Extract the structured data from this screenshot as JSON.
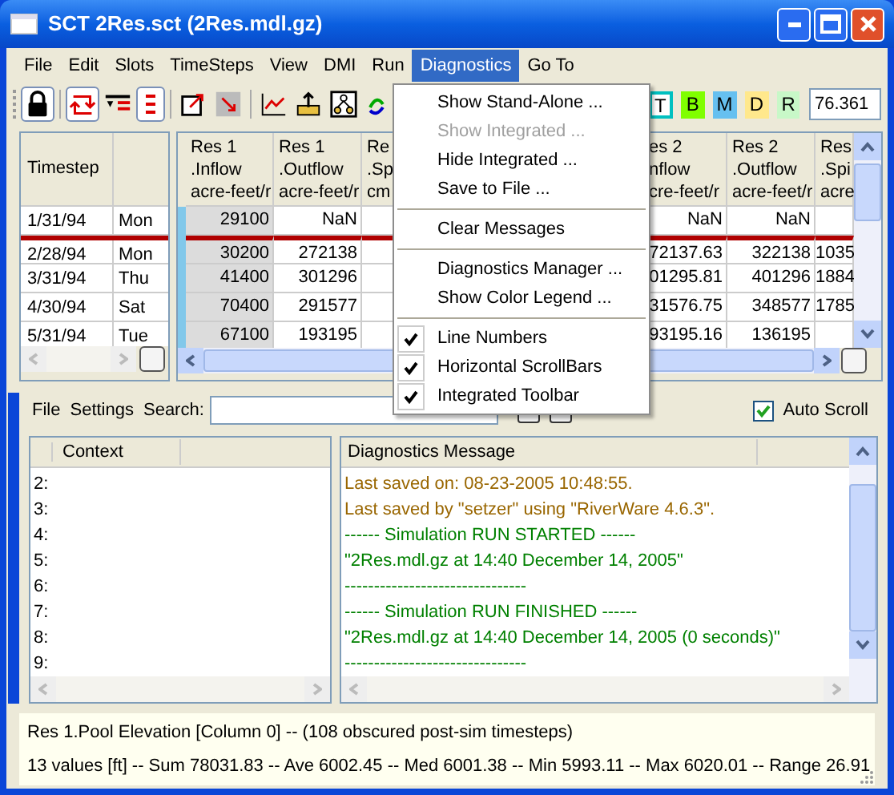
{
  "window": {
    "title": "SCT 2Res.sct (2Res.mdl.gz)"
  },
  "menu_bar": [
    {
      "label": "File",
      "selected": false
    },
    {
      "label": "Edit",
      "selected": false
    },
    {
      "label": "Slots",
      "selected": false
    },
    {
      "label": "TimeSteps",
      "selected": false
    },
    {
      "label": "View",
      "selected": false
    },
    {
      "label": "DMI",
      "selected": false
    },
    {
      "label": "Run",
      "selected": false
    },
    {
      "label": "Diagnostics",
      "selected": true
    },
    {
      "label": "Go To",
      "selected": false
    }
  ],
  "toolbar": {
    "icons": [
      {
        "kind": "lock",
        "pressed": true
      },
      {
        "kind": "swap",
        "pressed": true
      },
      {
        "kind": "filter",
        "pressed": false
      },
      {
        "kind": "list",
        "pressed": true
      },
      {
        "kind": "open-box",
        "pressed": false
      },
      {
        "kind": "close-box",
        "pressed": false
      },
      {
        "kind": "chart",
        "pressed": false
      },
      {
        "kind": "export",
        "pressed": false
      },
      {
        "kind": "tree",
        "pressed": false
      },
      {
        "kind": "partial"
      }
    ],
    "color_buttons": [
      {
        "label": "T",
        "color": "#ffffff"
      },
      {
        "label": "B",
        "color": "#80ff00"
      },
      {
        "label": "M",
        "color": "#66c0f0"
      },
      {
        "label": "D",
        "color": "#ffe88c"
      },
      {
        "label": "R",
        "color": "#c8f8c8"
      }
    ],
    "value_field": "76.361"
  },
  "timestep_table": {
    "columns": [
      "Timestep"
    ],
    "rows": [
      {
        "date": "1/31/94",
        "day": "Mon",
        "after_run_start_marker": false
      },
      {
        "date": "2/28/94",
        "day": "Mon",
        "after_run_start_marker": true
      },
      {
        "date": "3/31/94",
        "day": "Thu",
        "after_run_start_marker": false
      },
      {
        "date": "4/30/94",
        "day": "Sat",
        "after_run_start_marker": false
      },
      {
        "date": "5/31/94",
        "day": "Tue",
        "after_run_start_marker": false
      }
    ]
  },
  "slot_table": {
    "columns": [
      {
        "header": [
          "Res 1",
          ".Inflow",
          "acre-feet/r"
        ],
        "kind": "input",
        "cells": [
          "29100",
          "30200",
          "41400",
          "70400",
          "67100"
        ]
      },
      {
        "header": [
          "Res 1",
          ".Outflow",
          "acre-feet/r"
        ],
        "kind": "output",
        "cells": [
          "NaN",
          "272138",
          "301296",
          "291577",
          "193195"
        ]
      },
      {
        "header": [
          "Re",
          ".Sp",
          "cm"
        ],
        "kind": "output"
      },
      {
        "kind": "hidden"
      },
      {
        "header": [
          "es 2",
          "nflow",
          "cre-feet/r"
        ],
        "kind": "output",
        "cells": [
          "NaN",
          "72137.63",
          "01295.81",
          "31576.75",
          "93195.16"
        ]
      },
      {
        "header": [
          "Res 2",
          ".Outflow",
          "acre-feet/r"
        ],
        "kind": "output",
        "cells": [
          "NaN",
          "322138",
          "401296",
          "348577",
          "136195"
        ]
      },
      {
        "header": [
          "Res",
          ".Spi",
          "acre"
        ],
        "kind": "output",
        "cells": [
          "",
          "1035",
          "1884",
          "1785",
          ""
        ]
      }
    ]
  },
  "diagnostics_menu": [
    {
      "kind": "item",
      "label": "Show Stand-Alone ...",
      "disabled": false
    },
    {
      "kind": "item",
      "label": "Show Integrated ...",
      "disabled": true
    },
    {
      "kind": "item",
      "label": "Hide Integrated ...",
      "disabled": false
    },
    {
      "kind": "item",
      "label": "Save to File ...",
      "disabled": false
    },
    {
      "kind": "separator"
    },
    {
      "kind": "item",
      "label": "Clear Messages",
      "disabled": false
    },
    {
      "kind": "separator"
    },
    {
      "kind": "item",
      "label": "Diagnostics Manager ...",
      "disabled": false
    },
    {
      "kind": "item",
      "label": "Show Color Legend ...",
      "disabled": false
    },
    {
      "kind": "separator"
    },
    {
      "kind": "check",
      "label": "Line Numbers",
      "checked": true
    },
    {
      "kind": "check",
      "label": "Horizontal ScrollBars",
      "checked": true
    },
    {
      "kind": "check",
      "label": "Integrated Toolbar",
      "checked": true
    }
  ],
  "diagnostics": {
    "menus": [
      "File",
      "Settings"
    ],
    "search_label": "Search:",
    "auto_scroll": {
      "label": "Auto Scroll",
      "checked": true
    },
    "context_header": "Context",
    "message_header": "Diagnostics Message",
    "lines": [
      {
        "number": "2:",
        "message": "Last saved on: 08-23-2005 10:48:55.",
        "color": "#996600"
      },
      {
        "number": "3:",
        "message": "Last saved by \"setzer\" using \"RiverWare 4.6.3\".",
        "color": "#996600"
      },
      {
        "number": "4:",
        "message": "------ Simulation RUN STARTED ------",
        "color": "#008000"
      },
      {
        "number": "5:",
        "message": "\"2Res.mdl.gz at 14:40 December 14, 2005\"",
        "color": "#008000"
      },
      {
        "number": "6:",
        "message": "-------------------------------",
        "color": "#008000"
      },
      {
        "number": "7:",
        "message": "------ Simulation RUN FINISHED ------",
        "color": "#008000"
      },
      {
        "number": "8:",
        "message": "\"2Res.mdl.gz at 14:40 December 14, 2005 (0 seconds)\"",
        "color": "#008000"
      },
      {
        "number": "9:",
        "message": "-------------------------------",
        "color": "#008000"
      }
    ]
  },
  "status_bar": [
    "Res 1.Pool Elevation [Column 0] -- (108 obscured post-sim timesteps)",
    "13 values [ft] -- Sum 78031.83 -- Ave 6002.45 -- Med 6001.38 -- Min 5993.11 -- Max 6020.01 -- Range 26.91"
  ]
}
